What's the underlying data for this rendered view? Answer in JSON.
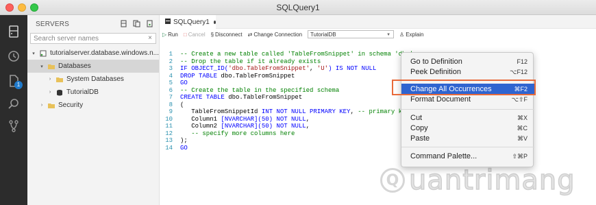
{
  "window": {
    "title": "SQLQuery1"
  },
  "sidebar": {
    "header": "SERVERS",
    "search_placeholder": "Search server names",
    "clear": "×",
    "tree": [
      {
        "label": "tutorialserver.database.windows.n...",
        "chevron": "▾"
      },
      {
        "label": "Databases",
        "chevron": "▾"
      },
      {
        "label": "System Databases",
        "chevron": "›"
      },
      {
        "label": "TutorialDB",
        "chevron": "›"
      },
      {
        "label": "Security",
        "chevron": "›"
      }
    ]
  },
  "activity": {
    "badge": "1"
  },
  "editor": {
    "tab_label": "SQLQuery1",
    "toolbar": {
      "run": "Run",
      "cancel": "Cancel",
      "disconnect": "Disconnect",
      "change_connection": "Change Connection",
      "database": "TutorialDB",
      "explain": "Explain"
    },
    "code_lines": [
      {
        "n": "1",
        "tokens": [
          {
            "t": "-- Create a new table called 'TableFromSnippet' in schema 'dbo'",
            "c": "comment"
          }
        ]
      },
      {
        "n": "2",
        "tokens": [
          {
            "t": "-- Drop the table if it already exists",
            "c": "comment"
          }
        ]
      },
      {
        "n": "3",
        "tokens": [
          {
            "t": "IF OBJECT_ID(",
            "c": "kw"
          },
          {
            "t": "'dbo.TableFromSnippet'",
            "c": "str"
          },
          {
            "t": ", ",
            "c": "plain"
          },
          {
            "t": "'U'",
            "c": "str"
          },
          {
            "t": ") IS NOT NULL",
            "c": "kw"
          }
        ]
      },
      {
        "n": "4",
        "tokens": [
          {
            "t": "DROP TABLE ",
            "c": "kw"
          },
          {
            "t": "dbo.TableFromSnippet",
            "c": "plain"
          }
        ]
      },
      {
        "n": "5",
        "tokens": [
          {
            "t": "GO",
            "c": "kw"
          }
        ]
      },
      {
        "n": "6",
        "tokens": [
          {
            "t": "-- Create the table in the specified schema",
            "c": "comment"
          }
        ]
      },
      {
        "n": "7",
        "tokens": [
          {
            "t": "CREATE TABLE ",
            "c": "kw"
          },
          {
            "t": "dbo.TableFromSnippet",
            "c": "plain"
          }
        ]
      },
      {
        "n": "8",
        "tokens": [
          {
            "t": "(",
            "c": "plain"
          }
        ]
      },
      {
        "n": "9",
        "tokens": [
          {
            "t": "   TableFromSnippetId ",
            "c": "plain"
          },
          {
            "t": "INT NOT NULL PRIMARY KEY",
            "c": "kw"
          },
          {
            "t": ", ",
            "c": "plain"
          },
          {
            "t": "-- primary key",
            "c": "comment"
          }
        ]
      },
      {
        "n": "10",
        "tokens": [
          {
            "t": "   Column1 ",
            "c": "plain"
          },
          {
            "t": "[NVARCHAR](50) NOT NULL",
            "c": "kw"
          },
          {
            "t": ",",
            "c": "plain"
          }
        ]
      },
      {
        "n": "11",
        "tokens": [
          {
            "t": "   Column2 ",
            "c": "plain"
          },
          {
            "t": "[NVARCHAR](50) NOT NULL",
            "c": "kw"
          },
          {
            "t": ",",
            "c": "plain"
          }
        ]
      },
      {
        "n": "12",
        "tokens": [
          {
            "t": "   -- specify more columns here",
            "c": "comment"
          }
        ]
      },
      {
        "n": "13",
        "tokens": [
          {
            "t": ");",
            "c": "plain"
          }
        ]
      },
      {
        "n": "14",
        "tokens": [
          {
            "t": "GO",
            "c": "kw"
          }
        ]
      }
    ]
  },
  "context_menu": {
    "items": [
      {
        "label": "Go to Definition",
        "shortcut": "F12"
      },
      {
        "label": "Peek Definition",
        "shortcut": "⌥F12"
      },
      {
        "label": "Change All Occurrences",
        "shortcut": "⌘F2"
      },
      {
        "label": "Format Document",
        "shortcut": "⌥⇧F"
      },
      {
        "label": "Cut",
        "shortcut": "⌘X"
      },
      {
        "label": "Copy",
        "shortcut": "⌘C"
      },
      {
        "label": "Paste",
        "shortcut": "⌘V"
      },
      {
        "label": "Command Palette...",
        "shortcut": "⇧⌘P"
      }
    ]
  },
  "watermark": {
    "glyph": "Q",
    "text": "uantrimang"
  },
  "colors": {
    "activity_bar": "#2c2c2c",
    "sidebar": "#f3f3f3",
    "menu_highlight": "#2f64d0",
    "callout_border": "#e86a3a",
    "keyword": "#0000ff",
    "comment": "#008000",
    "string": "#a31515",
    "line_number": "#2b91af"
  }
}
